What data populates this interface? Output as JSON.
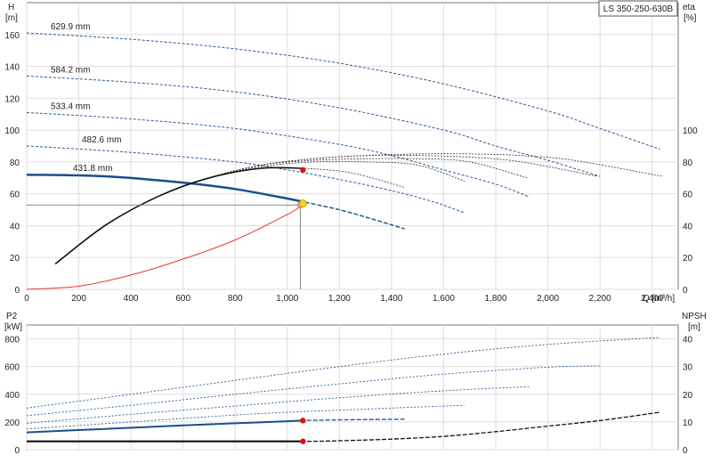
{
  "chart_data": [
    {
      "type": "line",
      "title": "LS 350-250-630B",
      "y_left_label": [
        "H",
        "[m]"
      ],
      "y_right_label": [
        "eta",
        "[%]"
      ],
      "x_label": "Q [m³/h]",
      "xlim": [
        0,
        2500
      ],
      "ylim_left": [
        0,
        180
      ],
      "ylim_right": [
        0,
        180
      ],
      "x_ticks": [
        0,
        200,
        400,
        600,
        800,
        1000,
        1200,
        1400,
        1600,
        1800,
        2000,
        2200,
        2400
      ],
      "x_tick_labels": [
        "0",
        "200",
        "400",
        "600",
        "800",
        "1,000",
        "1,200",
        "1,400",
        "1,600",
        "1,800",
        "2,000",
        "2,200",
        "2,400"
      ],
      "y_left_ticks": [
        0,
        20,
        40,
        60,
        80,
        100,
        120,
        140,
        160
      ],
      "y_right_ticks": [
        0,
        20,
        40,
        60,
        80,
        100
      ],
      "head_curves": [
        {
          "name": "629.9 mm",
          "x": [
            0,
            400,
            800,
            1200,
            1600,
            2000,
            2200,
            2430
          ],
          "y": [
            161,
            157,
            151,
            142,
            129,
            112,
            101,
            88
          ]
        },
        {
          "name": "584.2 mm",
          "x": [
            0,
            400,
            800,
            1200,
            1600,
            1800,
            2000,
            2200
          ],
          "y": [
            134,
            130,
            124,
            114,
            100,
            90,
            81,
            71
          ]
        },
        {
          "name": "533.4 mm",
          "x": [
            0,
            400,
            800,
            1200,
            1400,
            1600,
            1800,
            1930
          ],
          "y": [
            111,
            107,
            101,
            91,
            84,
            75,
            66,
            58
          ]
        },
        {
          "name": "482.6 mm",
          "x": [
            0,
            400,
            800,
            1000,
            1200,
            1400,
            1560,
            1680
          ],
          "y": [
            90,
            86,
            80,
            75,
            69,
            62,
            55,
            48
          ]
        },
        {
          "name": "431.8 mm",
          "x": [
            0,
            300,
            600,
            800,
            1000,
            1060,
            1200,
            1350,
            1450
          ],
          "y": [
            72,
            71,
            67,
            63,
            57,
            55,
            50,
            43,
            38
          ]
        }
      ],
      "efficiency_curves": [
        {
          "x": [
            110,
            300,
            500,
            700,
            900,
            1100,
            1300,
            1500,
            1700,
            1900,
            2100,
            2440
          ],
          "y": [
            16,
            40,
            58,
            70,
            78,
            82,
            84,
            85,
            85,
            84,
            81,
            71
          ]
        },
        {
          "x": [
            110,
            300,
            500,
            700,
            900,
            1100,
            1300,
            1500,
            1700,
            1900,
            2190
          ],
          "y": [
            16,
            40,
            58,
            70,
            78,
            82,
            84,
            84,
            83,
            80,
            71
          ]
        },
        {
          "x": [
            110,
            300,
            500,
            700,
            900,
            1100,
            1300,
            1500,
            1700,
            1920
          ],
          "y": [
            16,
            40,
            58,
            70,
            78,
            81,
            82,
            82,
            80,
            70
          ]
        },
        {
          "x": [
            110,
            300,
            500,
            700,
            900,
            1100,
            1300,
            1500,
            1680
          ],
          "y": [
            16,
            40,
            58,
            70,
            77,
            80,
            80,
            78,
            68
          ]
        },
        {
          "x": [
            110,
            300,
            500,
            700,
            900,
            1060,
            1250,
            1450
          ],
          "y": [
            16,
            40,
            58,
            70,
            76,
            76,
            73,
            64
          ]
        }
      ],
      "system_curve": {
        "x": [
          0,
          200,
          400,
          600,
          800,
          1000,
          1060
        ],
        "y": [
          0,
          2,
          9,
          19,
          31,
          47,
          53
        ]
      },
      "duty_point": {
        "x": 1060,
        "y": 54
      },
      "duty_head": 53,
      "duty_q": 1050,
      "marker_points": [
        {
          "x": 1060,
          "y": 75
        }
      ]
    },
    {
      "type": "line",
      "y_left_label": [
        "P2",
        "[kW]"
      ],
      "y_right_label": [
        "NPSH",
        "[m]"
      ],
      "xlim": [
        0,
        2500
      ],
      "ylim_left": [
        0,
        900
      ],
      "ylim_right": [
        0,
        45
      ],
      "y_left_ticks": [
        0,
        200,
        400,
        600,
        800
      ],
      "y_right_ticks": [
        0,
        10,
        20,
        30,
        40
      ],
      "power_curves": [
        {
          "x": [
            0,
            400,
            800,
            1200,
            1600,
            2000,
            2430
          ],
          "y": [
            300,
            400,
            500,
            600,
            690,
            760,
            810
          ]
        },
        {
          "x": [
            0,
            400,
            800,
            1200,
            1600,
            2000,
            2200
          ],
          "y": [
            245,
            320,
            400,
            475,
            545,
            595,
            605
          ]
        },
        {
          "x": [
            0,
            400,
            800,
            1200,
            1600,
            1930
          ],
          "y": [
            190,
            255,
            315,
            375,
            425,
            455
          ]
        },
        {
          "x": [
            0,
            400,
            800,
            1000,
            1200,
            1400,
            1680
          ],
          "y": [
            150,
            200,
            250,
            270,
            285,
            300,
            320
          ]
        },
        {
          "x": [
            0,
            300,
            600,
            800,
            1000,
            1060,
            1200,
            1450
          ],
          "y": [
            125,
            150,
            175,
            190,
            205,
            210,
            215,
            220
          ]
        }
      ],
      "npsh_curve": {
        "x": [
          0,
          400,
          800,
          1060,
          1200,
          1400,
          1600,
          1800,
          2000,
          2200,
          2430
        ],
        "y": [
          3,
          3,
          3,
          3,
          3.2,
          3.8,
          4.8,
          6.5,
          8.5,
          10.5,
          13.5
        ]
      },
      "marker_points": [
        {
          "x": 1060,
          "y": 210
        },
        {
          "x": 1060,
          "y": 60
        }
      ]
    }
  ]
}
